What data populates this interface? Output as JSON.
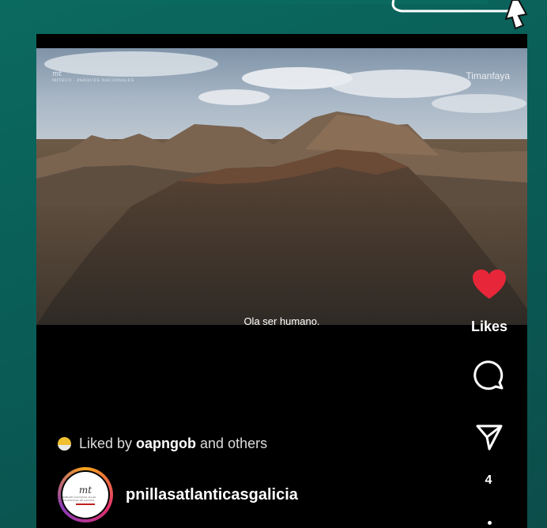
{
  "video": {
    "watermark_left": "mt",
    "watermark_left_sub": "MITECO · PARQUES NACIONALES",
    "watermark_right": "Timanfaya",
    "caption": "Ola ser humano,"
  },
  "actions": {
    "likes_label": "Likes",
    "share_count": "4",
    "heart_color": "#e8263a"
  },
  "liked_by": {
    "prefix": "Liked by ",
    "user": "oapngob",
    "suffix": " and others"
  },
  "account": {
    "avatar_text": "mt",
    "avatar_subtext": "PARQUE NACIONAL ILLAS ATLÁNTICAS DE GALICIA",
    "username": "pnillasatlanticasgalicia"
  }
}
